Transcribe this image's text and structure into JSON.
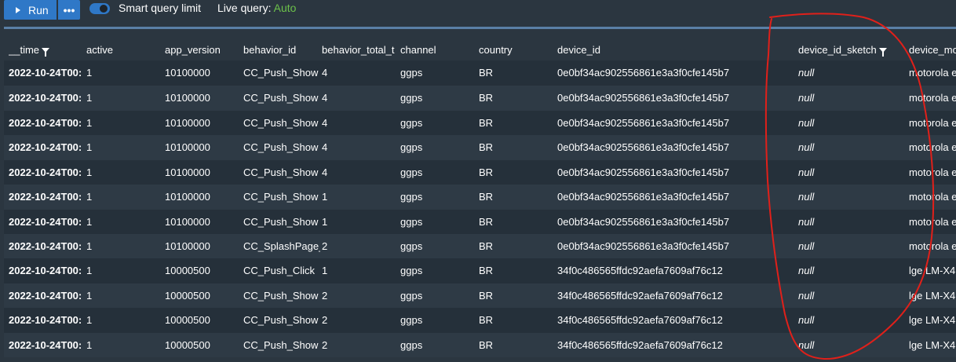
{
  "toolbar": {
    "run_label": "Run",
    "more_label": "•••",
    "smart_query_label": "Smart query limit",
    "smart_query_enabled": true,
    "live_query_label": "Live query:",
    "live_query_value": "Auto",
    "colors": {
      "button": "#2f78c7",
      "live_value": "#6cc24a"
    }
  },
  "table": {
    "columns": [
      {
        "key": "time",
        "label": "__time",
        "filter": true
      },
      {
        "key": "active",
        "label": "active",
        "filter": false
      },
      {
        "key": "app_version",
        "label": "app_version",
        "filter": false
      },
      {
        "key": "behavior_id",
        "label": "behavior_id",
        "filter": false
      },
      {
        "key": "behavior_total",
        "label": "behavior_total_t",
        "filter": false
      },
      {
        "key": "channel",
        "label": "channel",
        "filter": false
      },
      {
        "key": "country",
        "label": "country",
        "filter": false
      },
      {
        "key": "device_id",
        "label": "device_id",
        "filter": false
      },
      {
        "key": "device_id_sketch",
        "label": "device_id_sketch",
        "filter": true
      },
      {
        "key": "device_model",
        "label": "device_mo",
        "filter": false
      }
    ],
    "rows": [
      [
        "2022-10-24T00:",
        "1",
        "10100000",
        "CC_Push_Show",
        "4",
        "ggps",
        "BR",
        "0e0bf34ac902556861e3a3f0cfe145b7",
        "null",
        "motorola e"
      ],
      [
        "2022-10-24T00:",
        "1",
        "10100000",
        "CC_Push_Show",
        "4",
        "ggps",
        "BR",
        "0e0bf34ac902556861e3a3f0cfe145b7",
        "null",
        "motorola e"
      ],
      [
        "2022-10-24T00:",
        "1",
        "10100000",
        "CC_Push_Show",
        "4",
        "ggps",
        "BR",
        "0e0bf34ac902556861e3a3f0cfe145b7",
        "null",
        "motorola e"
      ],
      [
        "2022-10-24T00:",
        "1",
        "10100000",
        "CC_Push_Show",
        "4",
        "ggps",
        "BR",
        "0e0bf34ac902556861e3a3f0cfe145b7",
        "null",
        "motorola e"
      ],
      [
        "2022-10-24T00:",
        "1",
        "10100000",
        "CC_Push_Show",
        "4",
        "ggps",
        "BR",
        "0e0bf34ac902556861e3a3f0cfe145b7",
        "null",
        "motorola e"
      ],
      [
        "2022-10-24T00:",
        "1",
        "10100000",
        "CC_Push_Show",
        "1",
        "ggps",
        "BR",
        "0e0bf34ac902556861e3a3f0cfe145b7",
        "null",
        "motorola e"
      ],
      [
        "2022-10-24T00:",
        "1",
        "10100000",
        "CC_Push_Show",
        "1",
        "ggps",
        "BR",
        "0e0bf34ac902556861e3a3f0cfe145b7",
        "null",
        "motorola e"
      ],
      [
        "2022-10-24T00:",
        "1",
        "10100000",
        "CC_SplashPage_S",
        "2",
        "ggps",
        "BR",
        "0e0bf34ac902556861e3a3f0cfe145b7",
        "null",
        "motorola e"
      ],
      [
        "2022-10-24T00:",
        "1",
        "10000500",
        "CC_Push_Click",
        "1",
        "ggps",
        "BR",
        "34f0c486565ffdc92aefa7609af76c12",
        "null",
        "lge LM-X4"
      ],
      [
        "2022-10-24T00:",
        "1",
        "10000500",
        "CC_Push_Show",
        "2",
        "ggps",
        "BR",
        "34f0c486565ffdc92aefa7609af76c12",
        "null",
        "lge LM-X4"
      ],
      [
        "2022-10-24T00:",
        "1",
        "10000500",
        "CC_Push_Show",
        "2",
        "ggps",
        "BR",
        "34f0c486565ffdc92aefa7609af76c12",
        "null",
        "lge LM-X4"
      ],
      [
        "2022-10-24T00:",
        "1",
        "10000500",
        "CC_Push_Show",
        "2",
        "ggps",
        "BR",
        "34f0c486565ffdc92aefa7609af76c12",
        "null",
        "lge LM-X4"
      ]
    ]
  },
  "annotation": {
    "color": "#e0201a"
  }
}
